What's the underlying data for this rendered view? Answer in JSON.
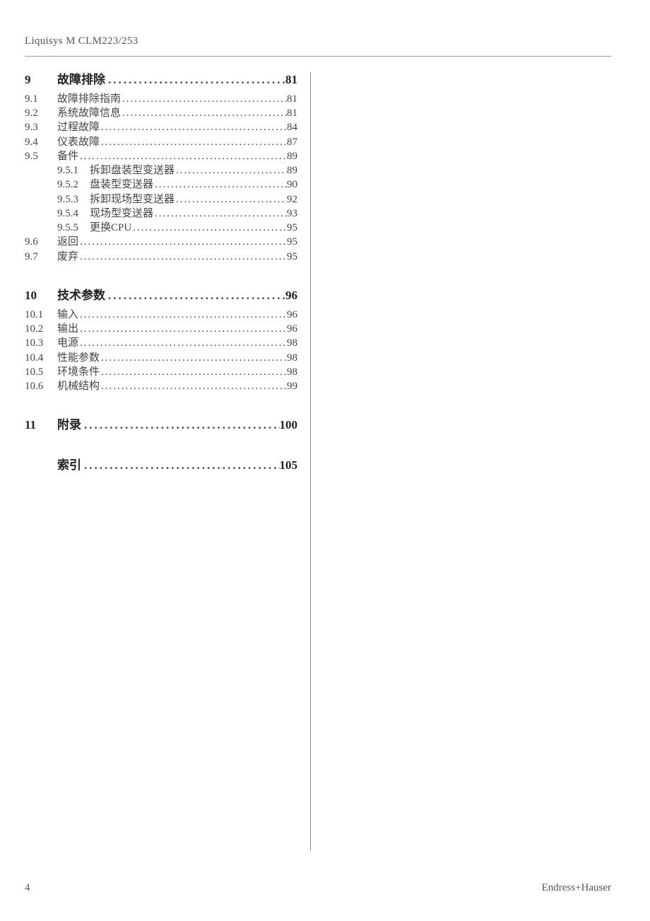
{
  "header": "Liquisys M CLM223/253",
  "footer": {
    "page": "4",
    "company": "Endress+Hauser"
  },
  "sections": [
    {
      "num": "9",
      "title": "故障排除",
      "page": "81",
      "subs": [
        {
          "num": "9.1",
          "title": "故障排除指南",
          "page": "81"
        },
        {
          "num": "9.2",
          "title": "系统故障信息",
          "page": "81"
        },
        {
          "num": "9.3",
          "title": "过程故障",
          "page": "84"
        },
        {
          "num": "9.4",
          "title": "仪表故障",
          "page": "87"
        },
        {
          "num": "9.5",
          "title": "备件",
          "page": "89",
          "subs": [
            {
              "num": "9.5.1",
              "title": "拆卸盘装型变送器",
              "page": "89"
            },
            {
              "num": "9.5.2",
              "title": "盘装型变送器",
              "page": "90"
            },
            {
              "num": "9.5.3",
              "title": "拆卸现场型变送器",
              "page": "92"
            },
            {
              "num": "9.5.4",
              "title": "现场型变送器",
              "page": "93"
            },
            {
              "num": "9.5.5",
              "title": "更换CPU",
              "page": "95"
            }
          ]
        },
        {
          "num": "9.6",
          "title": "返回",
          "page": "95"
        },
        {
          "num": "9.7",
          "title": "废弃",
          "page": "95"
        }
      ]
    },
    {
      "num": "10",
      "title": "技术参数",
      "page": "96",
      "subs": [
        {
          "num": "10.1",
          "title": "输入",
          "page": "96"
        },
        {
          "num": "10.2",
          "title": "输出",
          "page": "96"
        },
        {
          "num": "10.3",
          "title": "电源",
          "page": "98"
        },
        {
          "num": "10.4",
          "title": "性能参数",
          "page": "98"
        },
        {
          "num": "10.5",
          "title": "环境条件",
          "page": "98"
        },
        {
          "num": "10.6",
          "title": "机械结构",
          "page": "99"
        }
      ]
    },
    {
      "num": "11",
      "title": "附录",
      "page": "100",
      "subs": []
    },
    {
      "num": "",
      "title": "索引",
      "page": "105",
      "subs": []
    }
  ]
}
